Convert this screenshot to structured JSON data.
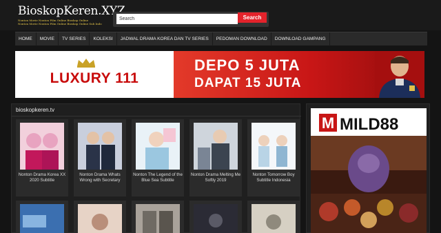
{
  "site": {
    "logo_title": "BioskopKeren.XYZ",
    "logo_line1": "Nonton Movie Nonton Film Online Bioskop Online",
    "logo_line2": "Nonton Movie Nonton Film Online Bioskop Online Sub Indo"
  },
  "search": {
    "placeholder": "Search",
    "button_label": "Search"
  },
  "nav": {
    "items": [
      "HOME",
      "MOVIE",
      "TV SERIES",
      "KOLEKSI",
      "JADWAL DRAMA KOREA DAN TV SERIES",
      "PEDOMAN DOWNLOAD",
      "DOWNLOAD GAMPANG"
    ]
  },
  "banner": {
    "brand": "LUXURY 111",
    "line1": "DEPO 5 JUTA",
    "line2": "DAPAT 15 JUTA",
    "accent": "#c81616"
  },
  "main": {
    "title": "bioskopkeren.tv",
    "posters": [
      {
        "caption": "Nonton Drama Korea XX 2020 Subtitle",
        "colors": [
          "#e8a3c0",
          "#f2d0dc"
        ]
      },
      {
        "caption": "Nonton Drama Whats Wrong with Secretary",
        "colors": [
          "#7c8aa6",
          "#c9cfdd"
        ]
      },
      {
        "caption": "Nonton The Legend of the Blue Sea Subtitle",
        "colors": [
          "#9bc7e0",
          "#e9f2f7"
        ]
      },
      {
        "caption": "Nonton Drama Melting Me Softly 2019",
        "colors": [
          "#7a8595",
          "#cfd5dc"
        ]
      },
      {
        "caption": "Nonton Tomorrow Boy Subtitle Indonesia",
        "colors": [
          "#b9d4e6",
          "#f4f7fa"
        ]
      },
      {
        "caption": "",
        "colors": [
          "#3b6fb0",
          "#88b4e0"
        ]
      },
      {
        "caption": "",
        "colors": [
          "#b98e7a",
          "#e7d3c6"
        ]
      },
      {
        "caption": "",
        "colors": [
          "#6f6a63",
          "#a9a29a"
        ]
      },
      {
        "caption": "",
        "colors": [
          "#2b2b35",
          "#5a5a66"
        ]
      },
      {
        "caption": "",
        "colors": [
          "#8f8a7d",
          "#d6d0c3"
        ]
      }
    ]
  },
  "sidebar": {
    "ad_brand": "MILD88"
  }
}
